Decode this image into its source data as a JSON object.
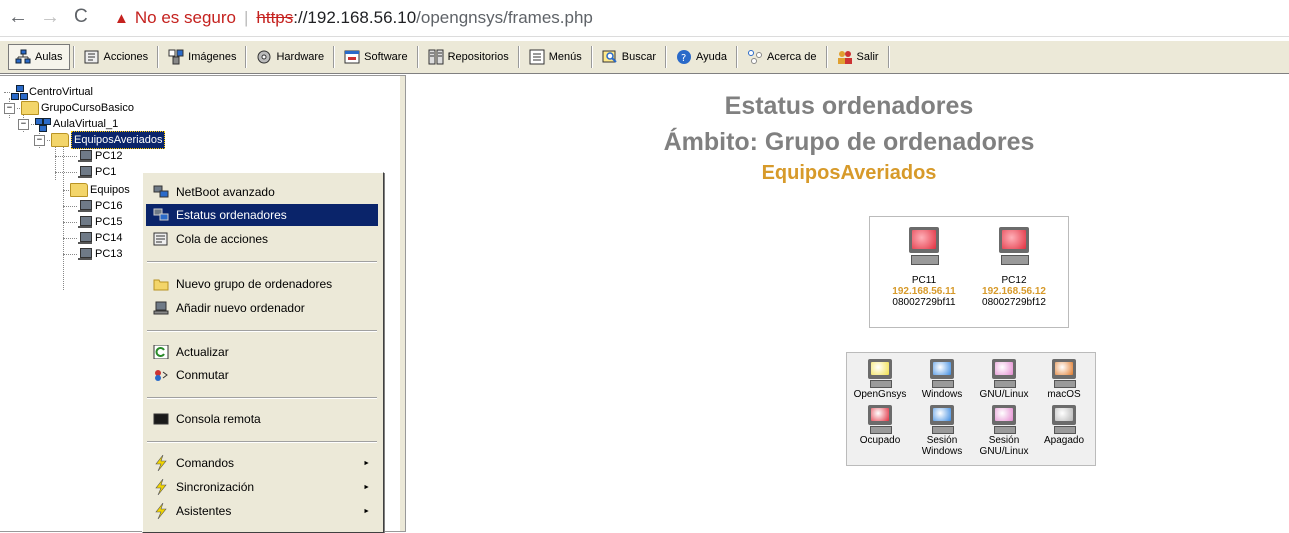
{
  "browser": {
    "back": "←",
    "forward": "→",
    "reload": "C",
    "security_warning": "No es seguro",
    "url_scheme": "https",
    "url_host": "://192.168.56.10",
    "url_path": "/opengnsys/frames.php"
  },
  "toolbar": {
    "items": [
      {
        "label": "Aulas"
      },
      {
        "label": "Acciones"
      },
      {
        "label": "Imágenes"
      },
      {
        "label": "Hardware"
      },
      {
        "label": "Software"
      },
      {
        "label": "Repositorios"
      },
      {
        "label": "Menús"
      },
      {
        "label": "Buscar"
      },
      {
        "label": "Ayuda"
      },
      {
        "label": "Acerca de"
      },
      {
        "label": "Salir"
      }
    ]
  },
  "tree": {
    "root": "CentroVirtual",
    "group": "GrupoCursoBasico",
    "room": "AulaVirtual_1",
    "selected": "EquiposAveriados",
    "pc12_partial": "PC12",
    "pc11_partial": "PC1",
    "folder2_partial": "Equipos",
    "pcs": [
      "PC16",
      "PC15",
      "PC14",
      "PC13"
    ]
  },
  "context_menu": {
    "items": [
      {
        "label": "NetBoot avanzado"
      },
      {
        "label": "Estatus ordenadores"
      },
      {
        "label": "Cola de acciones"
      },
      {
        "label": "Nuevo grupo de ordenadores"
      },
      {
        "label": "Añadir nuevo ordenador"
      },
      {
        "label": "Actualizar"
      },
      {
        "label": "Conmutar"
      },
      {
        "label": "Consola remota"
      },
      {
        "label": "Comandos"
      },
      {
        "label": "Sincronización"
      },
      {
        "label": "Asistentes"
      }
    ],
    "submenu_arrow": "►"
  },
  "main": {
    "title": "Estatus ordenadores",
    "scope": "Ámbito: Grupo de ordenadores",
    "group_name": "EquiposAveriados",
    "computers": [
      {
        "name": "PC11",
        "ip": "192.168.56.11",
        "mac": "08002729bf11",
        "state_color": "#e03040"
      },
      {
        "name": "PC12",
        "ip": "192.168.56.12",
        "mac": "08002729bf12",
        "state_color": "#e03040"
      }
    ],
    "legend": [
      {
        "label": "OpenGnsys",
        "color": "#f1e04a"
      },
      {
        "label": "Windows",
        "color": "#3d8be0"
      },
      {
        "label": "GNU/Linux",
        "color": "#e48ad0"
      },
      {
        "label": "macOS",
        "color": "#e07a2a"
      },
      {
        "label": "Ocupado",
        "color": "#e03040"
      },
      {
        "label": "Sesión Windows",
        "color": "#3d8be0"
      },
      {
        "label": "Sesión GNU/Linux",
        "color": "#e48ad0"
      },
      {
        "label": "Apagado",
        "color": "#b5b5b5"
      }
    ]
  }
}
